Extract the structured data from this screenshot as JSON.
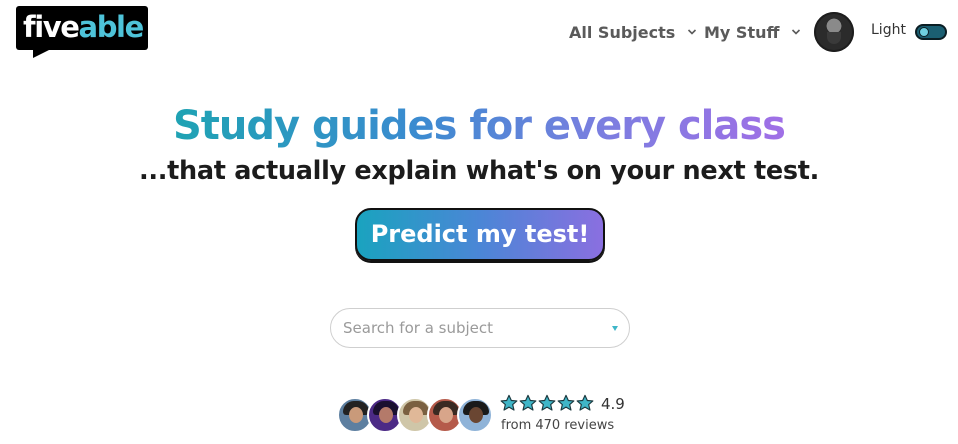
{
  "header": {
    "logo": {
      "part1": "five",
      "part2": "able"
    },
    "nav": [
      {
        "label": "All Subjects",
        "icon": "chevron-down-icon"
      },
      {
        "label": "My Stuff",
        "icon": "chevron-down-icon"
      }
    ],
    "theme_toggle": {
      "label": "Light",
      "state": "light"
    }
  },
  "hero": {
    "headline": "Study guides for every class",
    "subline": "...that actually explain what's on your next test.",
    "cta_label": "Predict my test!"
  },
  "search": {
    "placeholder": "Search for a subject",
    "value": ""
  },
  "social_proof": {
    "star_count": 5,
    "rating": "4.9",
    "reviews_text": "from 470 reviews"
  },
  "colors": {
    "brand_teal": "#4ec3d9",
    "cta_gradient_start": "#1aa3bf",
    "cta_gradient_end": "#8a6fe0",
    "star_fill": "#3fb6c8"
  }
}
